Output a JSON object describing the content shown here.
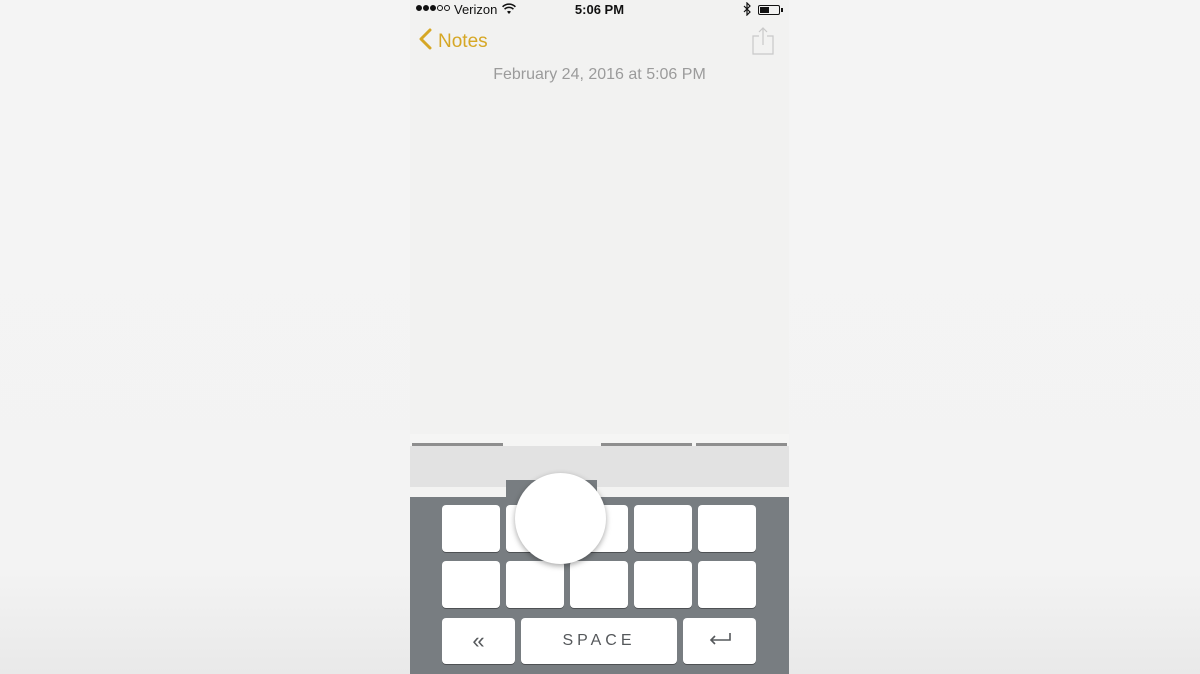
{
  "status_bar": {
    "carrier": "Verizon",
    "signal_bars_filled": 3,
    "signal_bars_total": 5,
    "time": "5:06 PM",
    "battery_level": 0.5,
    "icons": [
      "wifi-icon",
      "bluetooth-icon",
      "battery-icon"
    ]
  },
  "nav": {
    "back_label": "Notes",
    "back_icon": "chevron-left-icon",
    "share_icon": "share-icon",
    "accent_color": "#d6a725"
  },
  "note": {
    "date": "February 24, 2016 at 5:06 PM",
    "body": ""
  },
  "handwriting_tabs": {
    "count": 4,
    "active_index": 1
  },
  "keyboard": {
    "row1_keys": [
      "",
      "",
      "",
      "",
      ""
    ],
    "row2_keys": [
      "",
      "",
      "",
      "",
      ""
    ],
    "backspace_label": "«",
    "space_label": "SPACE",
    "return_icon": "return-arrow-icon",
    "background_color": "#787d81"
  }
}
